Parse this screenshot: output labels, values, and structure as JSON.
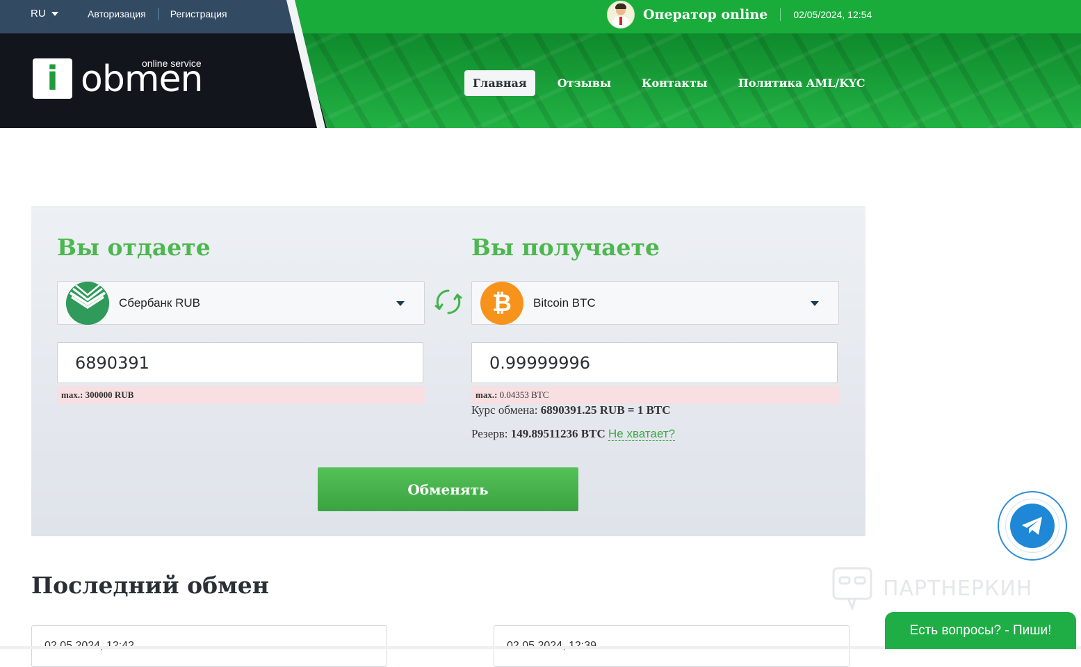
{
  "topbar": {
    "language": "RU",
    "login_label": "Авторизация",
    "register_label": "Регистрация",
    "operator_status": "Оператор online",
    "datetime": "02/05/2024, 12:54"
  },
  "logo": {
    "letter": "i",
    "word": "obmen",
    "tagline": "online service"
  },
  "nav": {
    "items": [
      {
        "label": "Главная",
        "active": true
      },
      {
        "label": "Отзывы",
        "active": false
      },
      {
        "label": "Контакты",
        "active": false
      },
      {
        "label": "Политика AML/KYC",
        "active": false
      }
    ]
  },
  "exchange": {
    "give": {
      "title": "Вы отдаете",
      "currency": "Сбербанк RUB",
      "amount": "6890391",
      "max_label": "max.:",
      "max_value": "300000 RUB"
    },
    "get": {
      "title": "Вы получаете",
      "currency": "Bitcoin BTC",
      "currency_symbol": "₿",
      "amount": "0.99999996",
      "max_label": "max.:",
      "max_value": "0.04353 BTC",
      "rate_label": "Курс обмена:",
      "rate_value": "6890391.25 RUB = 1 BTC",
      "reserve_label": "Резерв:",
      "reserve_value": "149.89511236 BTC",
      "reserve_link": "Не хватает?"
    },
    "submit_label": "Обменять"
  },
  "last_exchange": {
    "title": "Последний обмен",
    "items": [
      {
        "time": "02.05.2024, 12:42"
      },
      {
        "time": "02.05.2024, 12:39"
      }
    ]
  },
  "widgets": {
    "watermark": "ПАРТНЕРКИН",
    "chat_label": "Есть вопросы? - Пиши!"
  },
  "colors": {
    "brand_green": "#4db74f",
    "header_green": "#1aa53a",
    "btc_orange": "#f7931a",
    "telegram_blue": "#1e88d6"
  }
}
